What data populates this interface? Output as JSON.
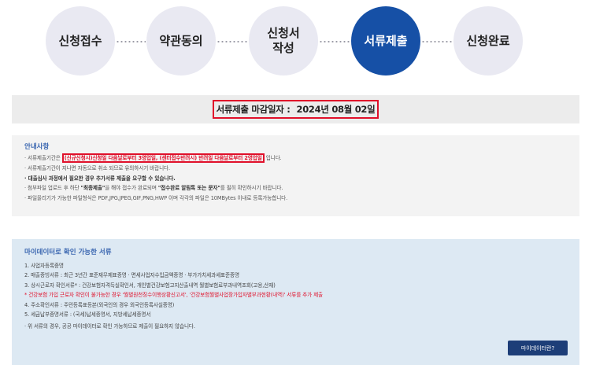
{
  "steps": [
    {
      "label": "신청접수",
      "active": false
    },
    {
      "label": "약관동의",
      "active": false
    },
    {
      "label": "신청서 작성",
      "line1": "신청서",
      "line2": "작성",
      "active": false
    },
    {
      "label": "서류제출",
      "active": true
    },
    {
      "label": "신청완료",
      "active": false
    }
  ],
  "deadline": {
    "label": "서류제출 마감일자 :",
    "date": "2024년 08월 02일"
  },
  "notice": {
    "title": "안내사항",
    "line1_prefix": "· 서류제출기간은 ",
    "line1_highlight": "(신규신청시)신청일 다음날로부터 3영업일, (센터접수반려시) 반려일 다음날로부터 2영업일",
    "line1_suffix": " 입니다.",
    "line2": "· 서류제출기간이 지나면 자동으로 취소 되므로 유의하시기 바랍니다.",
    "line3": "· 대출심사 과정에서 필요한 경우 추가서류 제출을 요구할 수 있습니다.",
    "line4_prefix": "· 첨부파일 업로드 후 하단 ",
    "line4_b1": "\"최종제출\"",
    "line4_mid": "을 해야 접수가 완료되며 ",
    "line4_b2": "\"접수완료 알림톡 또는 문자\"",
    "line4_suffix": "를 필히 확인하시기 바랍니다.",
    "line5": "· 파일올리기가 가능한 파일형식은 PDF,JPG,JPEG,GIF,PNG,HWP 이며 각각의 파일은 10MBytes 이내로 등록가능합니다."
  },
  "mydata": {
    "title": "마이데이터로 확인 가능한 서류",
    "items": [
      "1. 사업자등록증명",
      "2. 매출증빙서류 : 최근 3년간 표준재무제표증명 · 면세사업자수입금액증명 · 부가가치세과세표준증명",
      "3. 상시근로자 확인서류* : 건강보험자격득실확인서, 개인별건강보험고지산출내역 월별보험료부과내역조회(고용,산재)",
      "* 건강보험 가입 근로자 확인이 불가능한 경우 '월별원천징수이행상황신고서', '건강보험월별사업장가입자별부과현황(내역)' 서류를 추가 제출",
      "4. 주소확인서류 : 주민등록표등본(외국인의 경우 외국인등록사실증명)",
      "5. 세금납부증명서류 : (국세)납세증명서, 지방세납세증명서",
      "· 위 서류의 경우, 공공 마이데이터로 확인 가능하므로 제출이 필요하지 않습니다."
    ],
    "button_label": "마이데이터란?"
  }
}
